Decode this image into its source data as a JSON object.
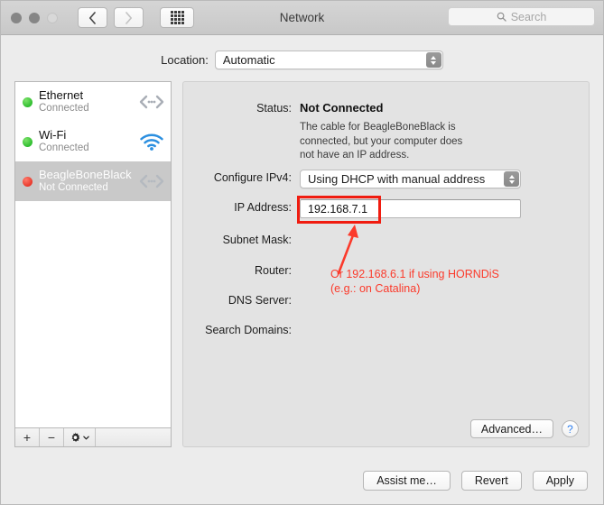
{
  "window": {
    "title": "Network",
    "traffic_lights": [
      "close",
      "minimize",
      "zoom"
    ]
  },
  "toolbar": {
    "back_icon": "chevron-left-icon",
    "forward_icon": "chevron-right-icon",
    "showall_icon": "grid-icon",
    "search": {
      "placeholder": "Search",
      "icon": "search-icon",
      "value": ""
    }
  },
  "location": {
    "label": "Location:",
    "value": "Automatic"
  },
  "services": [
    {
      "name": "Ethernet",
      "status": "Connected",
      "dot": "green",
      "icon": "ethernet-icon",
      "selected": false
    },
    {
      "name": "Wi-Fi",
      "status": "Connected",
      "dot": "green",
      "icon": "wifi-icon",
      "selected": false
    },
    {
      "name": "BeagleBoneBlack",
      "status": "Not Connected",
      "dot": "red",
      "icon": "ethernet-icon",
      "selected": true
    }
  ],
  "service_toolbar": {
    "add_label": "+",
    "remove_label": "−",
    "actions_icon": "gear-icon"
  },
  "detail": {
    "status": {
      "label": "Status:",
      "value": "Not Connected",
      "description": "The cable for BeagleBoneBlack is connected, but your computer does not have an IP address."
    },
    "configure_ipv4": {
      "label": "Configure IPv4:",
      "value": "Using DHCP with manual address"
    },
    "ip_address": {
      "label": "IP Address:",
      "value": "192.168.7.1"
    },
    "subnet_mask": {
      "label": "Subnet Mask:",
      "value": ""
    },
    "router": {
      "label": "Router:",
      "value": ""
    },
    "dns_server": {
      "label": "DNS Server:",
      "value": ""
    },
    "search_domains": {
      "label": "Search Domains:",
      "value": ""
    },
    "advanced_label": "Advanced…",
    "help_label": "?"
  },
  "annotation": {
    "line1": "Or 192.168.6.1 if using HORNDiS",
    "line2": "(e.g.: on Catalina)",
    "color": "#fb3a2b",
    "box_color": "#f01c10"
  },
  "footer": {
    "assist_label": "Assist me…",
    "revert_label": "Revert",
    "apply_label": "Apply"
  }
}
